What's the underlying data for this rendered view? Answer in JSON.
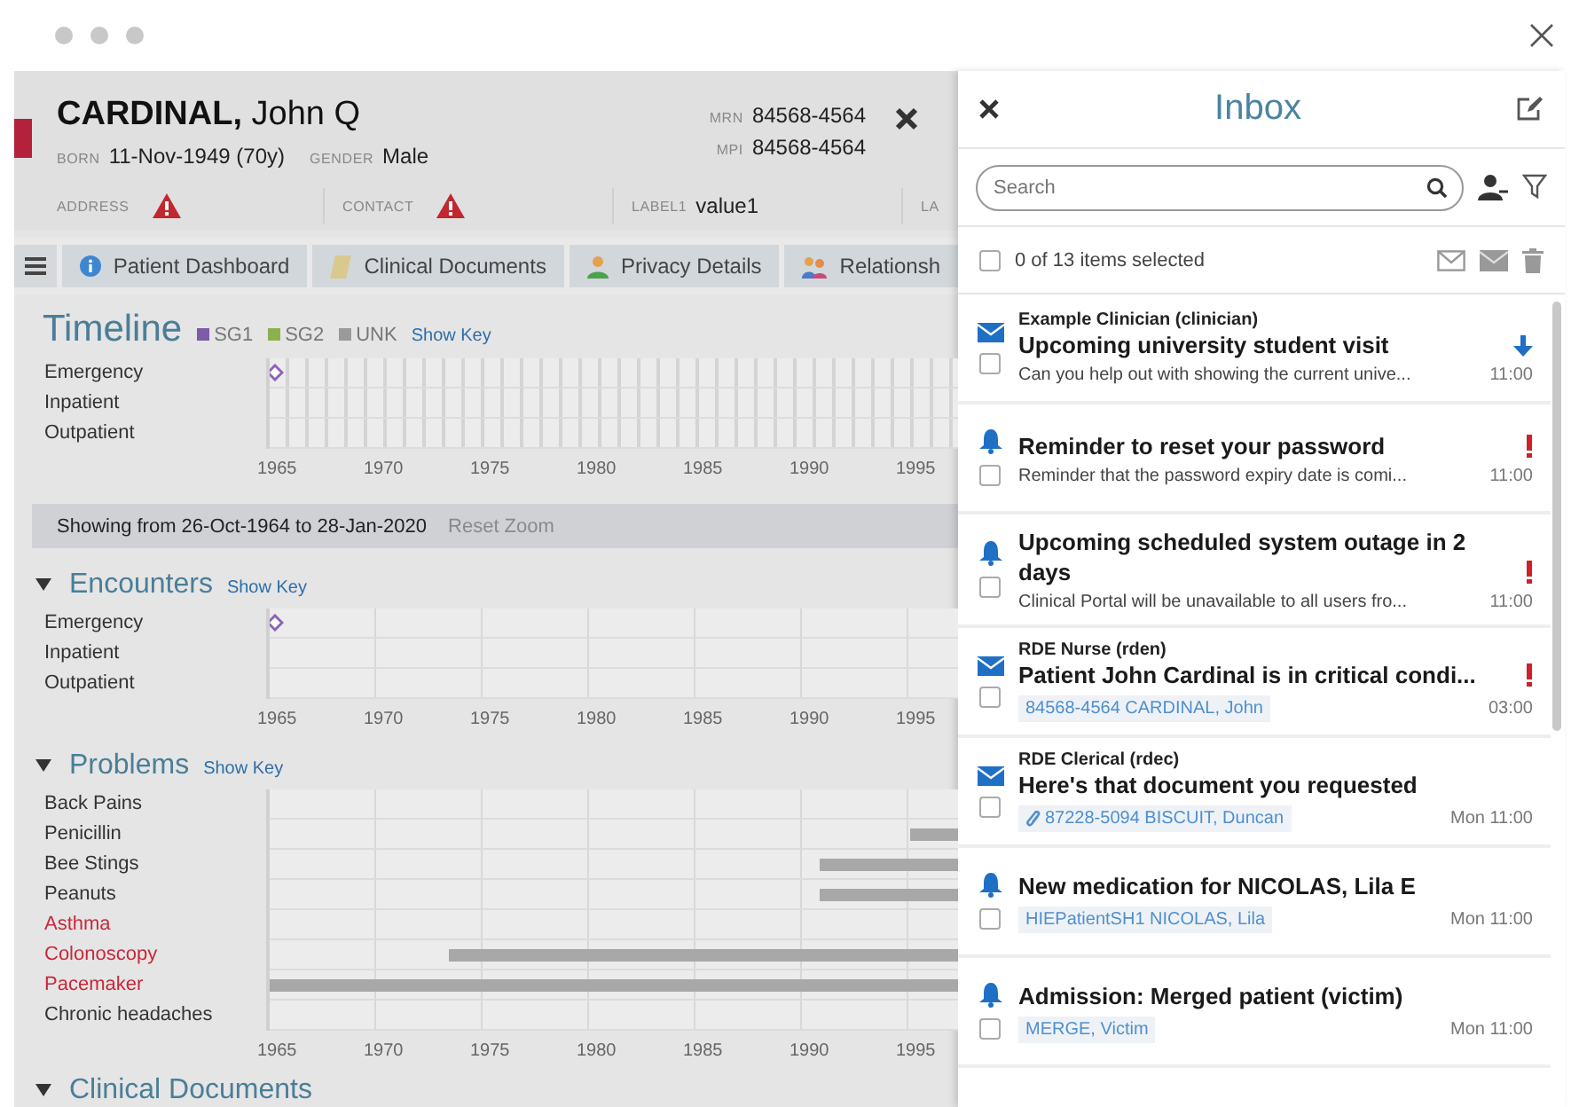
{
  "patient": {
    "name": "**CARDINAL,** John Q",
    "fields": [
      {
        "label": "BORN",
        "value": "11-Nov-1949 (70y)"
      },
      {
        "label": "GENDER",
        "value": "Male"
      }
    ],
    "ids": [
      {
        "label": "MRN",
        "value": "84568-4564"
      },
      {
        "label": "MPI",
        "value": "84568-4564"
      }
    ],
    "details": [
      {
        "kind": "warning",
        "label": "ADDRESS"
      },
      {
        "kind": "warning",
        "label": "CONTACT"
      },
      {
        "kind": "value",
        "label": "LABEL1",
        "value": "value1"
      },
      {
        "kind": "value",
        "label": "LA"
      }
    ]
  },
  "tabs": [
    {
      "kind": "info",
      "label": "Patient Dashboard"
    },
    {
      "kind": "document",
      "label": "Clinical Documents"
    },
    {
      "kind": "person",
      "label": "Privacy Details"
    },
    {
      "kind": "people",
      "label": "Relationsh"
    }
  ],
  "timeline": {
    "title": "Timeline",
    "legend": [
      {
        "label": "SG1",
        "color": "#7d5ba6"
      },
      {
        "label": "SG2",
        "color": "#8db04f"
      },
      {
        "label": "UNK",
        "color": "#9a9a9a"
      }
    ],
    "show_key": "Show Key",
    "rows": [
      {
        "label": "Emergency",
        "has_event": true
      },
      {
        "label": "Inpatient",
        "has_event": false
      },
      {
        "label": "Outpatient",
        "has_event": false
      }
    ],
    "axis": [
      "1965",
      "1970",
      "1975",
      "1980",
      "1985",
      "1990",
      "1995"
    ]
  },
  "zoom_bar": {
    "text": "Showing from 26-Oct-1964 to 28-Jan-2020",
    "reset": "Reset Zoom"
  },
  "encounters": {
    "title": "Encounters",
    "expanded": true,
    "show_key": "Show Key",
    "rows": [
      {
        "label": "Emergency",
        "has_event": true
      },
      {
        "label": "Inpatient",
        "has_event": false
      },
      {
        "label": "Outpatient",
        "has_event": false
      }
    ],
    "axis": [
      "1965",
      "1970",
      "1975",
      "1980",
      "1985",
      "1990",
      "1995"
    ]
  },
  "problems": {
    "title": "Problems",
    "expanded": true,
    "show_key": "Show Key",
    "rows": [
      {
        "label": "Back Pains",
        "alert": false
      },
      {
        "label": "Penicillin",
        "alert": false,
        "level": 0.07
      },
      {
        "label": "Bee Stings",
        "alert": false,
        "level": 0.2
      },
      {
        "label": "Peanuts",
        "alert": false,
        "level": 0.2
      },
      {
        "label": "Asthma",
        "alert": true
      },
      {
        "label": "Colonoscopy",
        "alert": true,
        "level": 0.74
      },
      {
        "label": "Pacemaker",
        "alert": true,
        "level": 1
      },
      {
        "label": "Chronic headaches",
        "alert": false
      }
    ],
    "axis": [
      "1965",
      "1970",
      "1975",
      "1980",
      "1985",
      "1990",
      "1995"
    ]
  },
  "clinical_documents": {
    "title": "Clinical Documents",
    "expanded": true
  },
  "inbox": {
    "title": "Inbox",
    "search_placeholder": "Search",
    "select_all_checked": false,
    "selection_text": "0 of 13 items selected",
    "items": [
      {
        "kind": "message",
        "sender": "Example Clinician (clinician)",
        "title": "Upcoming university student visit",
        "preview": "Can you help out with showing the current unive...",
        "time": "11:00",
        "arrow": true,
        "urgent": false,
        "checked": false
      },
      {
        "kind": "notification",
        "title": "Reminder to reset your password",
        "preview": "Reminder that the password expiry date is comi...",
        "time": "11:00",
        "arrow": false,
        "urgent": true,
        "checked": false
      },
      {
        "kind": "notification",
        "title": "Upcoming scheduled system outage in 2 days",
        "preview": "Clinical Portal will be unavailable to all users fro...",
        "time": "11:00",
        "arrow": false,
        "urgent": true,
        "checked": false
      },
      {
        "kind": "message",
        "sender": "RDE Nurse (rden)",
        "title": "Patient John Cardinal is in critical condi...",
        "tag": "84568-4564 CARDINAL, John",
        "time": "03:00",
        "arrow": false,
        "urgent": true,
        "checked": false
      },
      {
        "kind": "message",
        "sender": "RDE Clerical (rdec)",
        "title": "Here's that document you requested",
        "tag": "87228-5094 BISCUIT, Duncan",
        "attachment": true,
        "time": "Mon 11:00",
        "arrow": false,
        "urgent": false,
        "checked": false
      },
      {
        "kind": "notification",
        "title": "New medication for NICOLAS, Lila E",
        "tag": "HIEPatientSH1 NICOLAS, Lila",
        "time": "Mon 11:00",
        "arrow": false,
        "urgent": false,
        "checked": false
      },
      {
        "kind": "notification",
        "title": "Admission: Merged patient (victim)",
        "tag": "MERGE, Victim",
        "time": "Mon 11:00",
        "arrow": false,
        "urgent": false,
        "checked": false
      }
    ]
  }
}
